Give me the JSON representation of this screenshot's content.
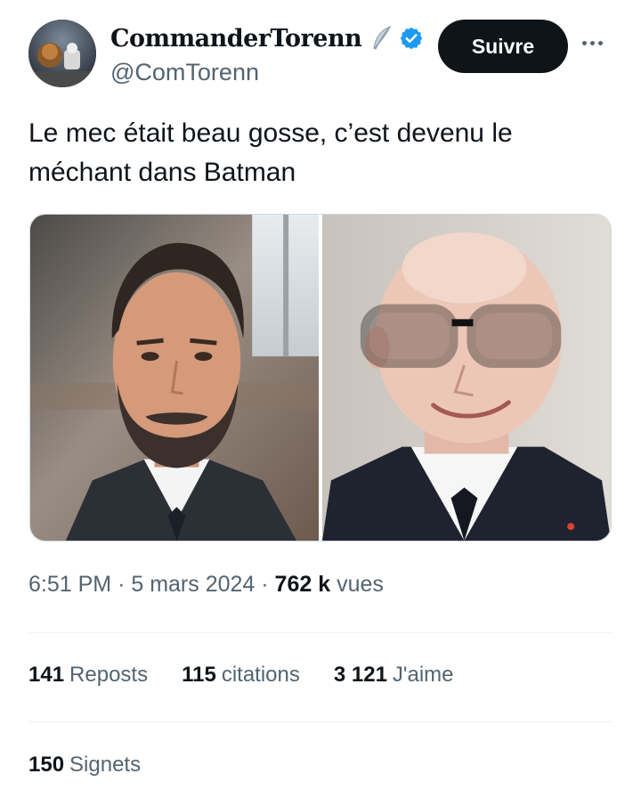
{
  "author": {
    "display_name": "CommanderTorenn",
    "handle": "@ComTorenn",
    "verified": true,
    "badge_icon": "feather-icon"
  },
  "header": {
    "follow_label": "Suivre",
    "more_icon": "more-horizontal-icon"
  },
  "tweet": {
    "text": "Le mec était beau gosse, c’est devenu le méchant dans Batman"
  },
  "media": {
    "count": 2
  },
  "meta": {
    "time": "6:51 PM",
    "separator": "·",
    "date": "5 mars 2024",
    "views_count": "762 k",
    "views_label": "vues"
  },
  "stats": {
    "reposts_count": "141",
    "reposts_label": "Reposts",
    "quotes_count": "115",
    "quotes_label": "citations",
    "likes_count": "3 121",
    "likes_label": "J'aime",
    "bookmarks_count": "150",
    "bookmarks_label": "Signets"
  },
  "colors": {
    "text_primary": "#0f1419",
    "text_secondary": "#536471",
    "verified_blue": "#1d9bf0",
    "button_bg": "#0f1419",
    "divider": "#eff3f4"
  }
}
